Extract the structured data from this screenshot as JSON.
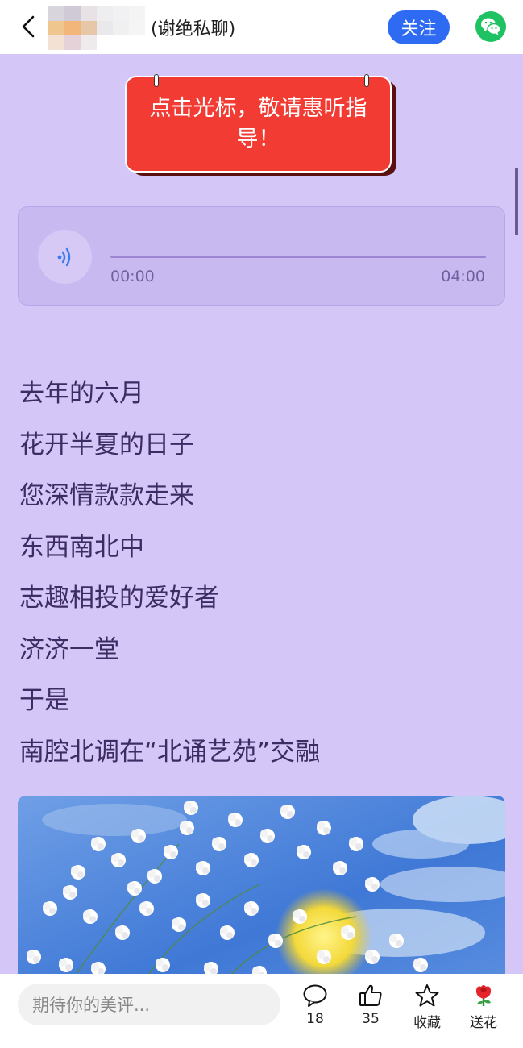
{
  "header": {
    "privacy_note": "(谢绝私聊)",
    "follow_label": "关注"
  },
  "banner": {
    "text": "点击光标，敬请惠听指导！"
  },
  "audio": {
    "current_time": "00:00",
    "duration": "04:00",
    "progress": 0
  },
  "poem": {
    "lines": [
      "去年的六月",
      "花开半夏的日子",
      "您深情款款走来",
      "东西南北中",
      "志趣相投的爱好者",
      "济济一堂",
      "于是",
      "南腔北调在“北诵艺苑”交融"
    ]
  },
  "footer": {
    "comment_placeholder": "期待你的美评...",
    "comment_count": "18",
    "like_count": "35",
    "favorite_label": "收藏",
    "flower_label": "送花"
  },
  "icons": {
    "back": "chevron-left-icon",
    "share": "wechat-icon",
    "audio": "speaker-icon",
    "comment": "speech-bubble-icon",
    "like": "thumbs-up-icon",
    "favorite": "star-icon",
    "flower": "rose-icon"
  },
  "colors": {
    "page_background": "#d4c6f7",
    "follow_button": "#2f6bf2",
    "banner": "#f23b33",
    "poem_text": "#3d2c63"
  }
}
